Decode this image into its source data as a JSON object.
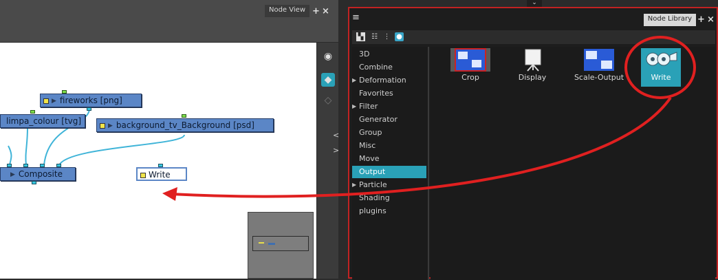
{
  "node_view": {
    "title": "Node View",
    "header_buttons": [
      "+",
      "×"
    ],
    "nodes": {
      "fireworks": "fireworks [png]",
      "limpa": "limpa_colour [tvg]",
      "background": "background_tv_Background [psd]",
      "composite": "Composite",
      "write": "Write"
    }
  },
  "node_library": {
    "title": "Node Library",
    "menu_icon": "≡",
    "header_buttons": [
      "+",
      "×"
    ],
    "categories": [
      {
        "label": "3D",
        "expandable": false
      },
      {
        "label": "Combine",
        "expandable": false
      },
      {
        "label": "Deformation",
        "expandable": true
      },
      {
        "label": "Favorites",
        "expandable": false
      },
      {
        "label": "Filter",
        "expandable": true
      },
      {
        "label": "Generator",
        "expandable": false
      },
      {
        "label": "Group",
        "expandable": false
      },
      {
        "label": "Misc",
        "expandable": false
      },
      {
        "label": "Move",
        "expandable": false
      },
      {
        "label": "Output",
        "expandable": false,
        "selected": true
      },
      {
        "label": "Particle",
        "expandable": true
      },
      {
        "label": "Shading",
        "expandable": false
      },
      {
        "label": "plugins",
        "expandable": false
      }
    ],
    "items": [
      {
        "label": "Crop",
        "icon": "crop-icon"
      },
      {
        "label": "Display",
        "icon": "display-icon"
      },
      {
        "label": "Scale-Output",
        "icon": "scale-output-icon"
      },
      {
        "label": "Write",
        "icon": "film-reel-icon",
        "selected": true
      }
    ]
  },
  "colors": {
    "accent": "#2aa1b7",
    "node_fill": "#5b86c6",
    "annotation": "#e02020"
  }
}
